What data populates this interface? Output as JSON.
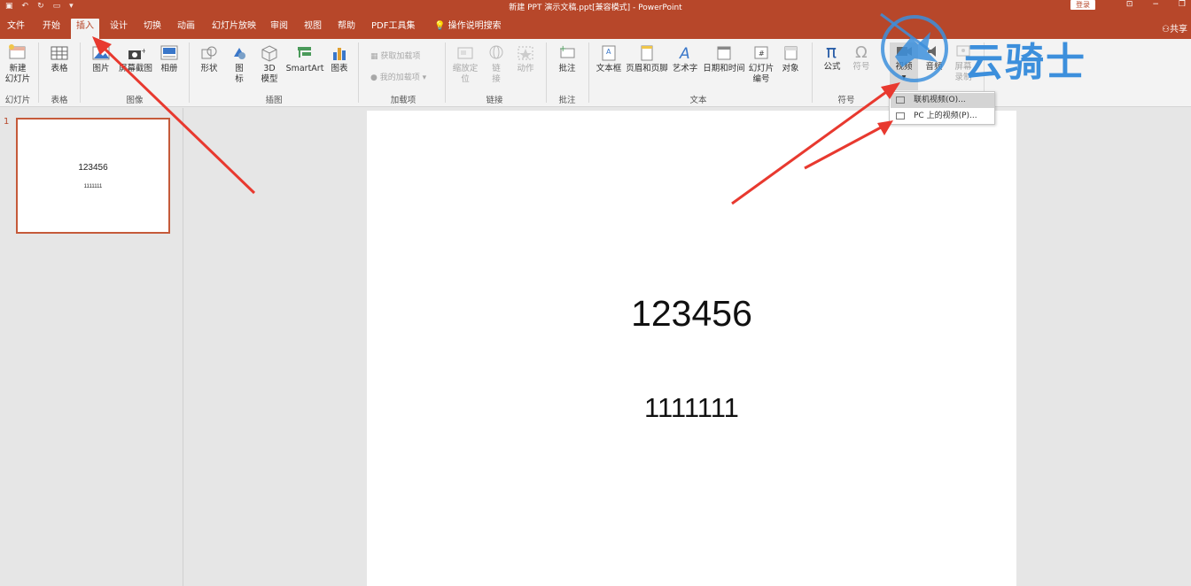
{
  "titlebar": {
    "title": "新建 PPT 演示文稿.ppt[兼容模式] - PowerPoint",
    "login": "登录"
  },
  "menu": {
    "tabs": [
      "文件",
      "开始",
      "插入",
      "设计",
      "切换",
      "动画",
      "幻灯片放映",
      "审阅",
      "视图",
      "帮助",
      "PDF工具集"
    ],
    "active": "插入",
    "tell_me": "操作说明搜索",
    "share": "共享"
  },
  "ribbon": {
    "new_slide": "新建\n幻灯片",
    "table": "表格",
    "picture": "图片",
    "screenshot": "屏幕截图",
    "album": "相册",
    "shapes": "形状",
    "icons": "图\n标",
    "model3d": "3D\n模型",
    "smartart": "SmartArt",
    "chart": "图表",
    "get_addins": "获取加载项",
    "my_addins": "我的加载项",
    "zoom": "缩放定\n位",
    "link": "链\n接",
    "action": "动作",
    "comment": "批注",
    "textbox": "文本框",
    "header_footer": "页眉和页脚",
    "wordart": "艺术字",
    "datetime": "日期和时间",
    "slide_number": "幻灯片\n编号",
    "object": "对象",
    "equation": "公式",
    "symbol": "符号",
    "video": "视频",
    "audio": "音频",
    "screen_record": "屏幕\n录制",
    "groups": {
      "slides": "幻灯片",
      "tables": "表格",
      "images": "图像",
      "illustrations": "插图",
      "addins": "加载项",
      "links": "链接",
      "comments": "批注",
      "text": "文本",
      "symbols": "符号"
    }
  },
  "dropdown": {
    "online_video": "联机视频(O)...",
    "pc_video": "PC 上的视频(P)..."
  },
  "thumbnail": {
    "number": "1",
    "title": "123456",
    "subtitle": "1111111"
  },
  "slide": {
    "title": "123456",
    "subtitle": "1111111"
  },
  "watermark": {
    "text": "云骑士"
  },
  "colors": {
    "accent": "#b7472a",
    "ribbon_bg": "#f3f3f3",
    "arrow": "#e8392f",
    "watermark": "#3c8fdc"
  }
}
